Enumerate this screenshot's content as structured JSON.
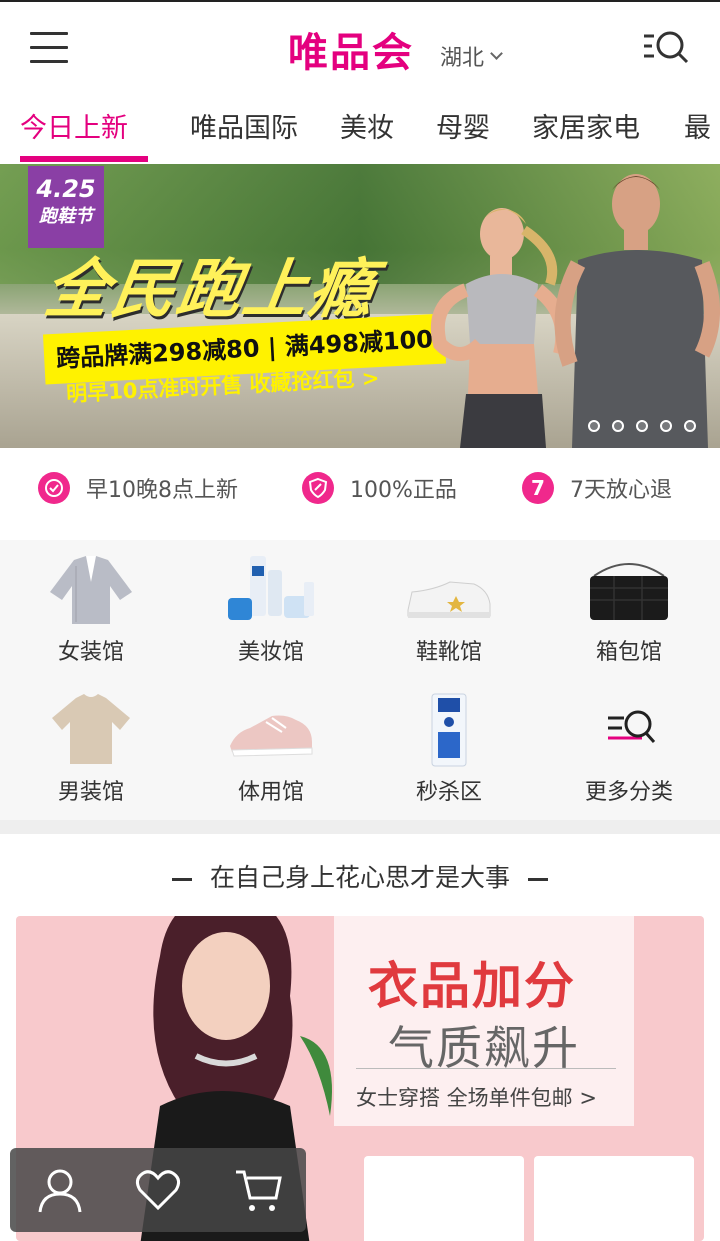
{
  "header": {
    "logo": "唯品会",
    "region": "湖北"
  },
  "tabs": [
    "今日上新",
    "唯品国际",
    "美妆",
    "母婴",
    "家居家电",
    "最"
  ],
  "banner": {
    "badge_date": "4.25",
    "badge_title": "跑鞋节",
    "headline": "全民跑上瘾",
    "promo": "跨品牌满298减80 | 满498减100",
    "subline": "明早10点准时开售 收藏抢红包 >",
    "slide_count": 5,
    "active_slide": 1
  },
  "features": [
    {
      "icon": "clock-icon",
      "label": "早10晚8点上新"
    },
    {
      "icon": "shield-icon",
      "label": "100%正品"
    },
    {
      "icon": "seven-day-icon",
      "icon_text": "7",
      "label": "7天放心退"
    }
  ],
  "categories": [
    {
      "icon": "womens-shirt-icon",
      "label": "女装馆"
    },
    {
      "icon": "cosmetics-icon",
      "label": "美妆馆"
    },
    {
      "icon": "sneaker-icon",
      "label": "鞋靴馆"
    },
    {
      "icon": "handbag-icon",
      "label": "箱包馆"
    },
    {
      "icon": "mens-tshirt-icon",
      "label": "男装馆"
    },
    {
      "icon": "sports-shoe-icon",
      "label": "体用馆"
    },
    {
      "icon": "face-mask-icon",
      "label": "秒杀区"
    },
    {
      "icon": "more-search-icon",
      "label": "更多分类"
    }
  ],
  "section": {
    "title": "在自己身上花心思才是大事",
    "card_headline": "衣品加分",
    "card_subheadline": "气质飙升",
    "card_caption": "女士穿搭 全场单件包邮 >"
  },
  "floating_bar": [
    "user-icon",
    "heart-icon",
    "cart-icon"
  ],
  "colors": {
    "brand": "#e4007f",
    "feature_icon": "#f0288c",
    "promo_red": "#e03a3e"
  }
}
